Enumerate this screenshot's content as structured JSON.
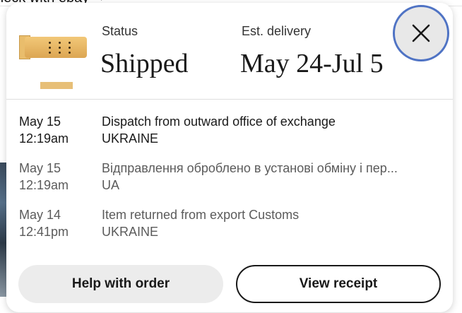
{
  "background": {
    "partial_text": "heck with ebay ➝"
  },
  "order": {
    "status_label": "Status",
    "status_value": "Shipped",
    "delivery_label": "Est. delivery",
    "delivery_value": "May 24-Jul 5"
  },
  "tracking": {
    "events": [
      {
        "date": "May 15",
        "time": "12:19am",
        "description": "Dispatch from outward office of exchange",
        "location": "UKRAINE"
      },
      {
        "date": "May 15",
        "time": "12:19am",
        "description": "Відправлення оброблено в установі обміну і пер...",
        "location": "UA"
      },
      {
        "date": "May 14",
        "time": "12:41pm",
        "description": "Item returned from export Customs",
        "location": "UKRAINE"
      }
    ]
  },
  "actions": {
    "help_label": "Help with order",
    "receipt_label": "View receipt"
  },
  "icons": {
    "close": "close-icon",
    "thumbnail": "product-thumbnail"
  },
  "colors": {
    "focus_ring": "#4f73c4",
    "text": "#191919",
    "muted_text": "#5b5b5b",
    "secondary_button_bg": "#ececec"
  }
}
